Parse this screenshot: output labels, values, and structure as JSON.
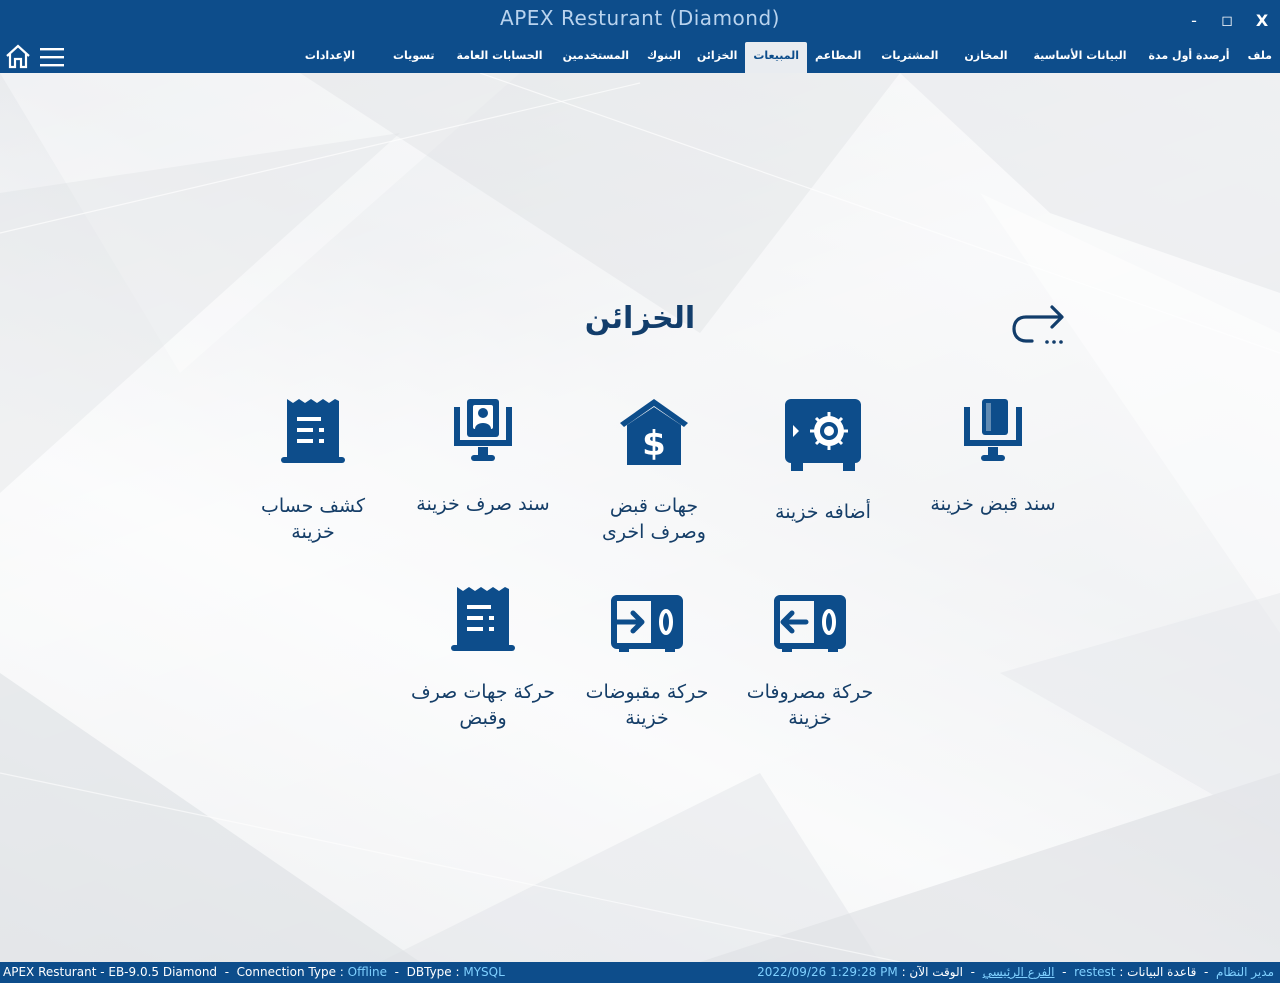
{
  "window": {
    "title": "APEX Resturant (Diamond)",
    "minimize": "-",
    "maximize": "◻",
    "close": "X"
  },
  "menu": [
    {
      "label": "ملف",
      "active": false
    },
    {
      "label": "أرصدة أول مدة",
      "active": false
    },
    {
      "label": "البيانات الأساسية",
      "active": false
    },
    {
      "label": "المخازن",
      "active": false
    },
    {
      "label": "المشتريات",
      "active": false
    },
    {
      "label": "المطاعم",
      "active": false
    },
    {
      "label": "المبيعات",
      "active": true
    },
    {
      "label": "الخزائن",
      "active": false
    },
    {
      "label": "البنوك",
      "active": false
    },
    {
      "label": "المستخدمين",
      "active": false
    },
    {
      "label": "الحسابات العامة",
      "active": false
    },
    {
      "label": "تسويات",
      "active": false
    },
    {
      "label": "الإعدادات",
      "active": false
    }
  ],
  "page": {
    "title": "الخزائن"
  },
  "tiles": [
    {
      "label_line1": "سند قبض خزينة",
      "label_line2": "",
      "icon": "receipt-voucher-icon"
    },
    {
      "label_line1": "أضافه خزينة",
      "label_line2": "",
      "icon": "safe-icon"
    },
    {
      "label_line1": "جهات قبض",
      "label_line2": "وصرف اخرى",
      "icon": "bank-dollar-icon"
    },
    {
      "label_line1": "سند صرف خزينة",
      "label_line2": "",
      "icon": "payment-voucher-icon"
    },
    {
      "label_line1": "كشف حساب",
      "label_line2": "خزينة",
      "icon": "statement-icon"
    },
    {
      "label_line1": "حركة مصروفات",
      "label_line2": "خزينة",
      "icon": "safe-out-icon"
    },
    {
      "label_line1": "حركة مقبوضات",
      "label_line2": "خزينة",
      "icon": "safe-in-icon"
    },
    {
      "label_line1": "حركة جهات صرف",
      "label_line2": "وقبض",
      "icon": "movement-statement-icon"
    }
  ],
  "status": {
    "app": "APEX Resturant - EB-9.0.5  Diamond",
    "sep": "-",
    "conn_label": "Connection Type :",
    "conn_value": "Offline",
    "db_label": "DBType :",
    "db_value": "MYSQL",
    "user_label": "مدير النظام",
    "database_label": "قاعدة البيانات :",
    "database_value": "restest",
    "branch_value": "الفرع الرئيسي",
    "time_label": "الوقت الآن :",
    "time_value": "2022/09/26  1:29:28 PM"
  },
  "colors": {
    "brand": "#0d4d8b",
    "icon": "#0d4d8b",
    "text": "#153e68"
  }
}
